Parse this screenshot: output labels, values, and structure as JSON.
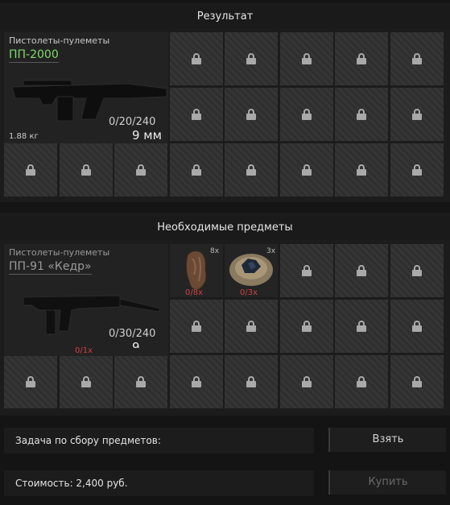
{
  "result": {
    "header": "Результат",
    "item": {
      "category": "Пистолеты-пулеметы",
      "name": "ПП-2000",
      "ammo": "0/20/240",
      "caliber": "9 мм",
      "weight": "1.88 кг"
    }
  },
  "required": {
    "header": "Необходимые предметы",
    "weapon": {
      "category": "Пистолеты-пулеметы",
      "name": "ПП-91 «Кедр»",
      "ammo": "0/30/240",
      "caliber": "9",
      "have": "0/1x"
    },
    "ingredients": [
      {
        "icon": "fabric-scrap-icon",
        "count": "8x",
        "have": "0/8x"
      },
      {
        "icon": "ore-rock-icon",
        "count": "3x",
        "have": "0/3x"
      }
    ]
  },
  "task": {
    "label": "Задача по сбору предметов:"
  },
  "cost": {
    "label": "Стоимость: 2,400 руб."
  },
  "buttons": {
    "take": "Взять",
    "buy": "Купить"
  },
  "colors": {
    "name_highlight": "#7fdc6a",
    "missing": "#d04040"
  }
}
